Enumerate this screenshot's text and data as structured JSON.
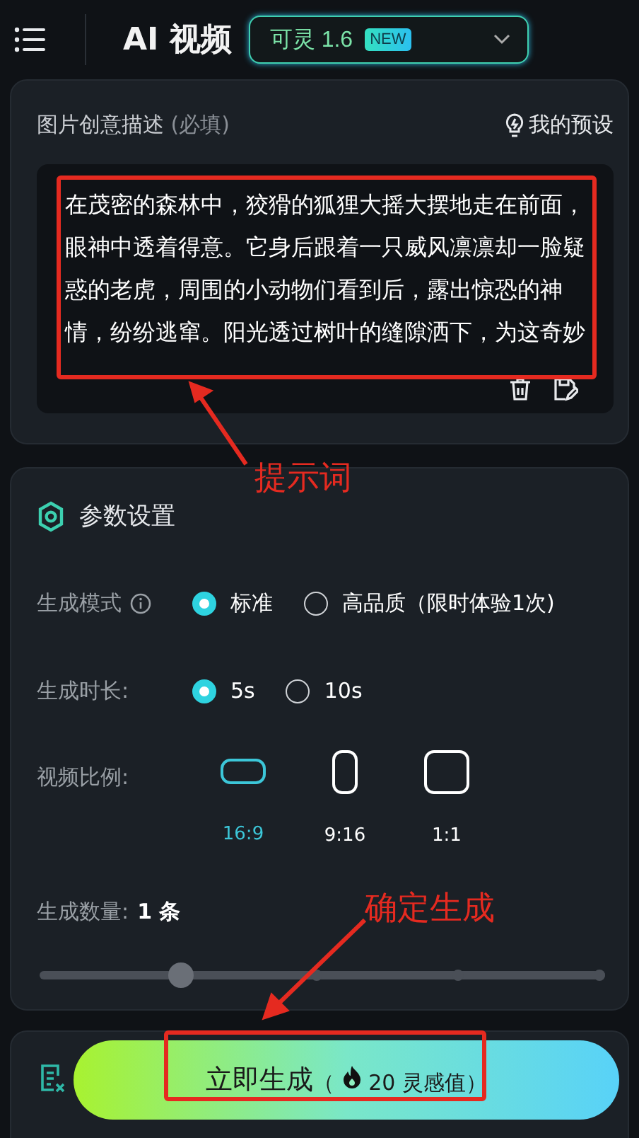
{
  "header": {
    "title": "AI 视频",
    "model": {
      "label": "可灵 1.6",
      "badge": "NEW"
    }
  },
  "prompt": {
    "label": "图片创意描述",
    "hint": "(必填)",
    "presets": "我的预设",
    "value": "在茂密的森林中，狡猾的狐狸大摇大摆地走在前面，眼神中透着得意。它身后跟着一只威风凛凛却一脸疑惑的老虎，周围的小动物们看到后，露出惊恐的神情，纷纷逃窜。阳光透过树叶的缝隙洒下，为这奇妙"
  },
  "params": {
    "title": "参数设置",
    "mode": {
      "label": "生成模式",
      "options": [
        {
          "label": "标准",
          "selected": true
        },
        {
          "label": "高品质（限时体验1次)",
          "selected": false
        }
      ]
    },
    "duration": {
      "label": "生成时长:",
      "options": [
        {
          "label": "5s",
          "selected": true
        },
        {
          "label": "10s",
          "selected": false
        }
      ]
    },
    "ratio": {
      "label": "视频比例:",
      "options": [
        {
          "label": "16:9",
          "kind": "wide",
          "selected": true
        },
        {
          "label": "9:16",
          "kind": "tall",
          "selected": false
        },
        {
          "label": "1:1",
          "kind": "square",
          "selected": false
        }
      ]
    },
    "count": {
      "label": "生成数量:",
      "value": "1 条",
      "level": 0.25
    }
  },
  "generate": {
    "label": "立即生成",
    "open": "（",
    "cost": "20 灵感值",
    "close": "）"
  },
  "annotations": [
    {
      "text": "提示词"
    },
    {
      "text": "确定生成"
    }
  ]
}
